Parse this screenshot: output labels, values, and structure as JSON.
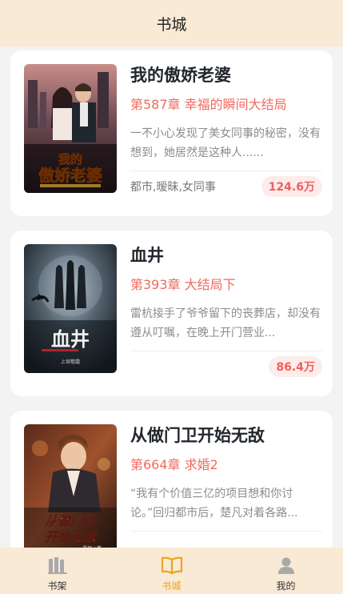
{
  "header": {
    "title": "书城"
  },
  "books": [
    {
      "title": "我的傲娇老婆",
      "chapter": "第587章 幸福的瞬间大结局",
      "description": "一不小心发现了美女同事的秘密，没有想到，她居然是这种人......",
      "tags": "都市,暧昧,女同事",
      "count": "124.6万",
      "cover_text": "我的 傲娇老婆"
    },
    {
      "title": "血井",
      "chapter": "第393章 大结局下",
      "description": "雷杭接手了爷爷留下的丧葬店，却没有遵从叮嘱，在晚上开门营业...",
      "tags": "",
      "count": "86.4万",
      "cover_text": "血井"
    },
    {
      "title": "从做门卫开始无敌",
      "chapter": "第664章 求婚2",
      "description": "“我有个价值三亿的项目想和你讨论。”回归都市后，楚凡对着各路...",
      "tags": "",
      "count": "",
      "cover_text": "从做门卫 开始无敌"
    }
  ],
  "tabbar": {
    "items": [
      {
        "label": "书架",
        "icon": "bookshelf-icon"
      },
      {
        "label": "书城",
        "icon": "open-book-icon"
      },
      {
        "label": "我的",
        "icon": "user-icon"
      }
    ],
    "active_color": "#f0a31d",
    "background": "#f8ead5"
  }
}
